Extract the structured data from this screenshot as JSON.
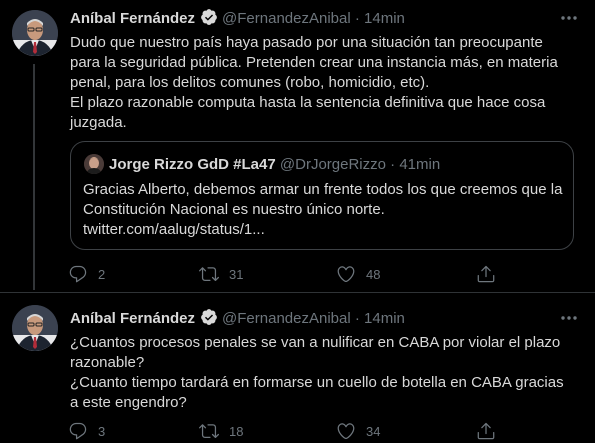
{
  "tweets": [
    {
      "author": {
        "name": "Aníbal Fernández",
        "handle": "@FernandezAnibal",
        "separator": "·",
        "time": "14min"
      },
      "lines": [
        "Dudo que nuestro país haya pasado por una situación tan preocupante para la seguridad pública. Pretenden crear una instancia más, en materia penal, para los delitos comunes (robo, homicidio, etc).",
        "El plazo razonable computa hasta la sentencia definitiva que hace cosa juzgada."
      ],
      "quote": {
        "name": "Jorge Rizzo GdD #La47",
        "handle": "@DrJorgeRizzo",
        "separator": "·",
        "time": "41min",
        "text": "Gracias Alberto, debemos armar un frente todos los que creemos que la Constitución Nacional es nuestro único norte.",
        "link": "twitter.com/aalug/status/1..."
      },
      "stats": {
        "replies": "2",
        "retweets": "31",
        "likes": "48"
      }
    },
    {
      "author": {
        "name": "Aníbal Fernández",
        "handle": "@FernandezAnibal",
        "separator": "·",
        "time": "14min"
      },
      "lines": [
        "¿Cuantos procesos penales se van a nulificar en CABA por violar el plazo razonable?",
        "¿Cuanto tiempo tardará en formarse un cuello de botella en CABA gracias a este engendro?"
      ],
      "stats": {
        "replies": "3",
        "retweets": "18",
        "likes": "34"
      }
    }
  ],
  "icons": {
    "verified": "verified-badge-icon",
    "more": "more-options-icon",
    "reply": "reply-icon",
    "retweet": "retweet-icon",
    "like": "heart-icon",
    "share": "share-icon"
  },
  "colors": {
    "background": "#000000",
    "text": "#d9d9d9",
    "secondary": "#6e767d",
    "border": "#2f3336"
  }
}
